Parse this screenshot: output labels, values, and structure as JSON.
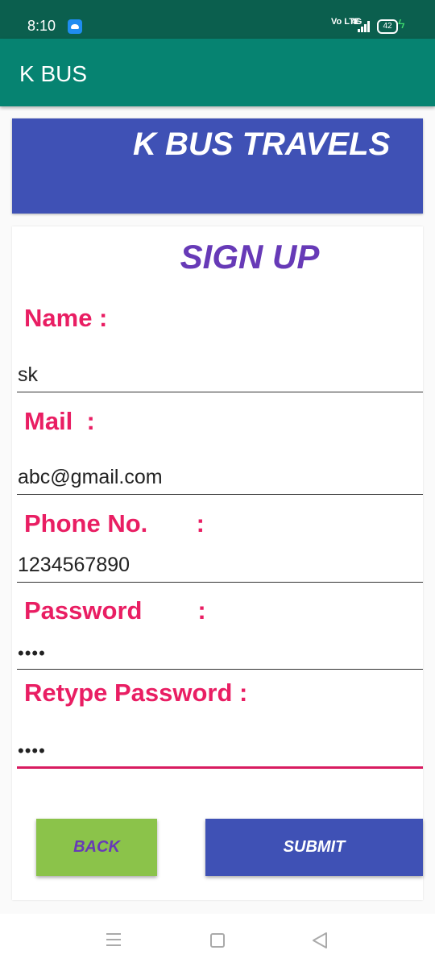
{
  "status_bar": {
    "time": "8:10",
    "network_label": "Vo LTE",
    "network_type": "4G",
    "battery": "42"
  },
  "app_bar": {
    "title": "K BUS"
  },
  "banner": {
    "title": "K BUS TRAVELS"
  },
  "form": {
    "title": "SIGN UP",
    "fields": [
      {
        "label": "Name :",
        "value": "sk"
      },
      {
        "label": "Mail  :",
        "value": "abc@gmail.com"
      },
      {
        "label": "Phone No.       :",
        "value": "1234567890"
      },
      {
        "label": "Password        :",
        "value": "••••"
      },
      {
        "label": "Retype Password :",
        "value": "••••"
      }
    ],
    "back_label": "BACK",
    "submit_label": "SUBMIT"
  },
  "colors": {
    "status_bar": "#0b5f4e",
    "app_bar": "#068371",
    "banner": "#3f51b5",
    "label": "#e91e63",
    "title": "#673ab7",
    "back_button": "#8bc34a",
    "submit_button": "#3f51b5"
  },
  "nav_bar": {
    "icons": [
      "menu-icon",
      "home-icon",
      "back-icon"
    ]
  }
}
